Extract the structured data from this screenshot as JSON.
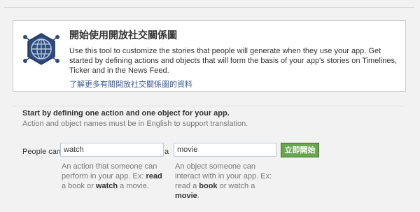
{
  "intro": {
    "title": "開始使用開放社交關係圖",
    "description": "Use this tool to customize the stories that people will generate when they use your app. Get started by defining actions and objects that will form the basis of your app's stories on Timelines, Ticker and in the News Feed.",
    "learn_more_link": "了解更多有關開放社交關係圖的資料",
    "logo_icon": "open-graph-globe-icon"
  },
  "define": {
    "heading": "Start by defining one action and one object for your app.",
    "subheading": "Action and object names must be in English to support translation.",
    "people_can_label": "People can",
    "action_value": "watch",
    "article_label": "a",
    "object_value": "movie",
    "submit_label": "立即開始",
    "action_help": {
      "line1": "An action that someone can",
      "line2_pre": "perform in your app. Ex: ",
      "line2_bold": "read",
      "line3_pre": "a book or ",
      "line3_bold": "watch",
      "line3_post": " a movie."
    },
    "object_help": {
      "line1": "An object someone can",
      "line2": "interact with in your app. Ex:",
      "line3_pre": "read a ",
      "line3_bold": "book",
      "line3_post": " or watch a",
      "line4_bold": "movie",
      "line4_post": "."
    }
  },
  "colors": {
    "link": "#3b5998",
    "button_bg": "#69a74e",
    "logo_fill": "#2e4b7a"
  }
}
